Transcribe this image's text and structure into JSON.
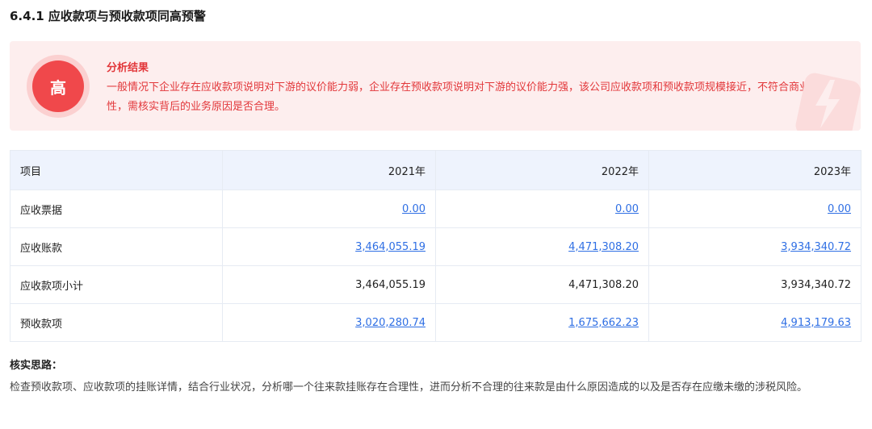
{
  "section": {
    "title": "6.4.1 应收款项与预收款项同高预警"
  },
  "alert": {
    "level": "高",
    "title": "分析结果",
    "text": "一般情况下企业存在应收款项说明对下游的议价能力弱，企业存在预收款项说明对下游的议价能力强，该公司应收款项和预收款项规模接近，不符合商业合理性，需核实背后的业务原因是否合理。",
    "accent_color": "#f0484b"
  },
  "table": {
    "headers": [
      "项目",
      "2021年",
      "2022年",
      "2023年"
    ],
    "rows": [
      {
        "label": "应收票据",
        "values": [
          "0.00",
          "0.00",
          "0.00"
        ],
        "link": true
      },
      {
        "label": "应收账款",
        "values": [
          "3,464,055.19",
          "4,471,308.20",
          "3,934,340.72"
        ],
        "link": true
      },
      {
        "label": "应收款项小计",
        "values": [
          "3,464,055.19",
          "4,471,308.20",
          "3,934,340.72"
        ],
        "link": false
      },
      {
        "label": "预收款项",
        "values": [
          "3,020,280.74",
          "1,675,662.23",
          "4,913,179.63"
        ],
        "link": true
      }
    ]
  },
  "notes": {
    "title": "核实思路：",
    "text": "检查预收款项、应收款项的挂账详情，结合行业状况，分析哪一个往来款挂账存在合理性，进而分析不合理的往来款是由什么原因造成的以及是否存在应缴未缴的涉税风险。"
  }
}
